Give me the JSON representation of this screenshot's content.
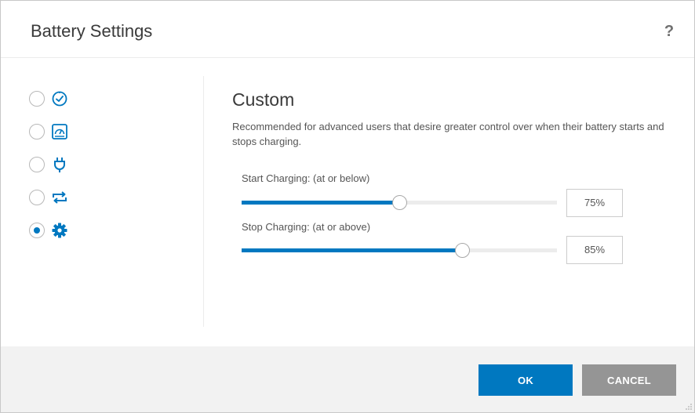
{
  "window": {
    "title": "Battery Settings",
    "help_glyph": "?"
  },
  "modes": [
    {
      "icon": "clock-check-icon",
      "selected": false
    },
    {
      "icon": "gauge-icon",
      "selected": false
    },
    {
      "icon": "plug-icon",
      "selected": false
    },
    {
      "icon": "cycle-arrows-icon",
      "selected": false
    },
    {
      "icon": "gear-icon",
      "selected": true
    }
  ],
  "custom": {
    "title": "Custom",
    "description": "Recommended for advanced users that desire greater control over when their battery starts and stops charging.",
    "start_label": "Start Charging: (at or below)",
    "start_value": 75,
    "start_display": "75%",
    "stop_label": "Stop Charging: (at or above)",
    "stop_value": 85,
    "stop_display": "85%"
  },
  "footer": {
    "ok_label": "OK",
    "cancel_label": "CANCEL"
  },
  "colors": {
    "accent": "#0078c0",
    "cancel": "#959595"
  }
}
